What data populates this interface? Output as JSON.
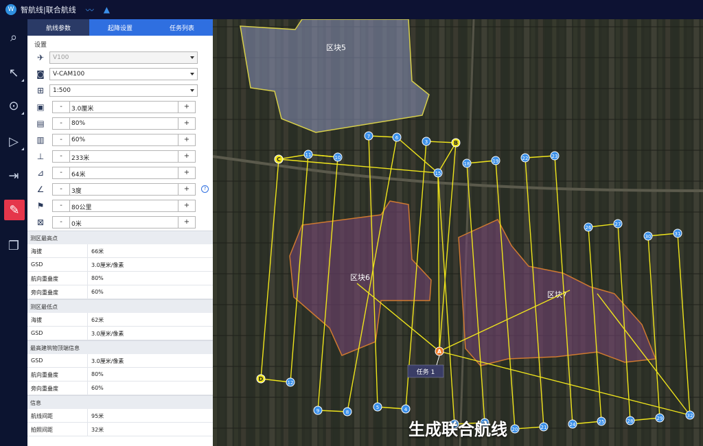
{
  "app": {
    "title": "智航线|联合航线",
    "logo": "W"
  },
  "toolbar": {
    "items": [
      {
        "name": "search-tool",
        "glyph": "⌕"
      },
      {
        "name": "select-tool",
        "glyph": "↖"
      },
      {
        "name": "point-tool",
        "glyph": "⊙"
      },
      {
        "name": "polygon-tool",
        "glyph": "▷"
      },
      {
        "name": "import-tool",
        "glyph": "⇥"
      },
      {
        "name": "route-edit-tool",
        "glyph": "✎"
      },
      {
        "name": "layers-tool",
        "glyph": "❐"
      }
    ]
  },
  "tabs": [
    "航线参数",
    "起降设置",
    "任务列表"
  ],
  "panel": {
    "device_label": "设置",
    "aircraft": "V100",
    "camera": "V-CAM100",
    "scale": "1:500",
    "params": [
      "3.0厘米",
      "80%",
      "60%",
      "233米",
      "64米",
      "3度",
      "80公里",
      "0米"
    ],
    "param_icons": [
      "gsd-icon",
      "forward-overlap-icon",
      "side-overlap-icon",
      "altitude-icon",
      "route-spacing-icon",
      "angle-icon",
      "speed-icon",
      "offset-icon"
    ],
    "minus": "-",
    "plus": "+",
    "help": "?"
  },
  "sections": [
    {
      "title": "测区最高点",
      "rows": [
        [
          "海拔",
          "66米"
        ],
        [
          "GSD",
          "3.0厘米/像素"
        ],
        [
          "航向重叠度",
          "80%"
        ],
        [
          "旁向重叠度",
          "60%"
        ]
      ]
    },
    {
      "title": "测区最低点",
      "rows": [
        [
          "海拔",
          "62米"
        ],
        [
          "GSD",
          "3.0厘米/像素"
        ]
      ]
    },
    {
      "title": "最高建筑物顶端信息",
      "rows": [
        [
          "GSD",
          "3.0厘米/像素"
        ],
        [
          "航向重叠度",
          "80%"
        ],
        [
          "旁向重叠度",
          "60%"
        ]
      ]
    },
    {
      "title": "信息",
      "rows": [
        [
          "航线间距",
          "95米"
        ],
        [
          "拍照间距",
          "32米"
        ]
      ]
    }
  ],
  "map": {
    "regions": [
      {
        "label": "区块5"
      },
      {
        "label": "区块6"
      },
      {
        "label": "区块7"
      }
    ],
    "route_color": "#f0e51c",
    "waypoint_color": "#3a8fe8",
    "task_label": "任务 1",
    "markers": [
      "A",
      "B",
      "C",
      "D"
    ],
    "caption": "生成联合航线"
  },
  "colors": {
    "accent": "#2f6fe0",
    "active_tab": "#2a3a66",
    "danger": "#e5364b"
  }
}
